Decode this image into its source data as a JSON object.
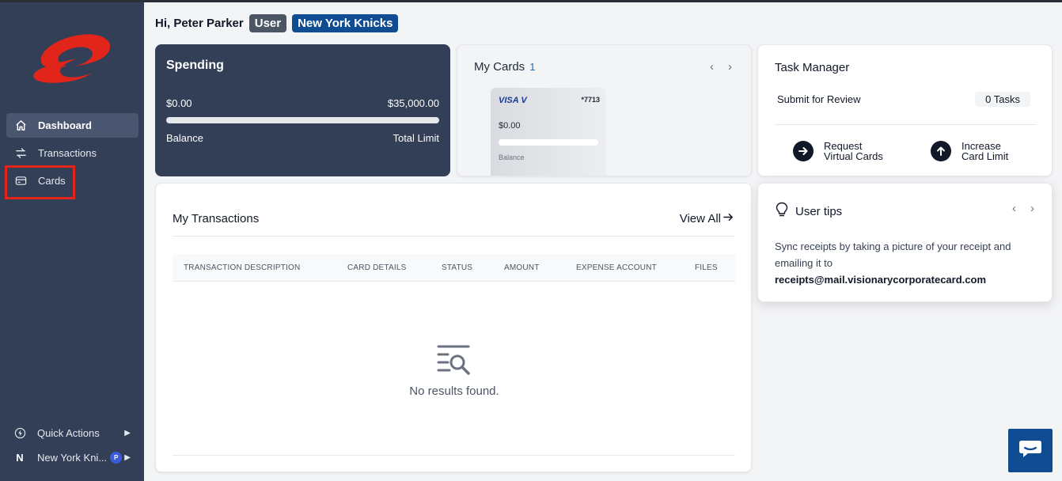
{
  "sidebar": {
    "nav": [
      {
        "label": "Dashboard",
        "icon": "home-icon",
        "active": true
      },
      {
        "label": "Transactions",
        "icon": "swap-arrows-icon",
        "active": false
      },
      {
        "label": "Cards",
        "icon": "credit-card-icon",
        "active": false
      }
    ],
    "quick_actions": {
      "label": "Quick Actions",
      "icon": "bolt-icon"
    },
    "organization": {
      "avatar": "N",
      "label": "New York Kni...",
      "badge": "P"
    }
  },
  "header": {
    "greeting": "Hi, Peter Parker",
    "role_badge": "User",
    "team_badge": "New York Knicks"
  },
  "spending": {
    "title": "Spending",
    "spent": "$0.00",
    "total": "$35,000.00",
    "left_label": "Balance",
    "right_label": "Total Limit",
    "progress_percent": 0
  },
  "my_cards": {
    "title": "My Cards",
    "count": "1",
    "prev": "‹",
    "next": "›",
    "card": {
      "brand": "VISA V",
      "last4": "*7713",
      "balance": "$0.00",
      "balance_label": "Balance"
    }
  },
  "task_manager": {
    "title": "Task Manager",
    "row_label": "Submit for Review",
    "tasks_count": "0 Tasks",
    "actions": [
      {
        "line1": "Request",
        "line2": "Virtual Cards",
        "icon": "arrow-right-circle-icon"
      },
      {
        "line1": "Increase",
        "line2": "Card Limit",
        "icon": "arrow-up-circle-icon"
      }
    ]
  },
  "transactions": {
    "title": "My Transactions",
    "view_all": "View All",
    "columns": [
      "TRANSACTION DESCRIPTION",
      "CARD DETAILS",
      "STATUS",
      "AMOUNT",
      "EXPENSE ACCOUNT",
      "FILES"
    ],
    "empty_message": "No results found."
  },
  "user_tips": {
    "title": "User tips",
    "prev": "‹",
    "next": "›",
    "text": "Sync receipts by taking a picture of your receipt and emailing it to",
    "email": "receipts@mail.visionarycorporatecard.com"
  },
  "colors": {
    "sidebar": "#323f56",
    "brand_red": "#e1251b",
    "team_blue": "#0f4c92",
    "highlight": "#e1251b"
  }
}
